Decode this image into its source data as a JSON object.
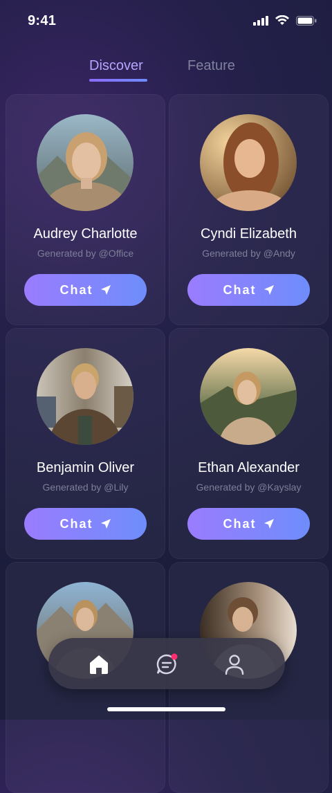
{
  "status_bar": {
    "time": "9:41"
  },
  "tabs": [
    {
      "label": "Discover",
      "active": true
    },
    {
      "label": "Feature",
      "active": false
    }
  ],
  "chat_button_label": "Chat",
  "cards": [
    {
      "name": "Audrey Charlotte",
      "generated_by": "Generated by @Office"
    },
    {
      "name": "Cyndi Elizabeth",
      "generated_by": "Generated by @Andy"
    },
    {
      "name": "Benjamin Oliver",
      "generated_by": "Generated by @Lily"
    },
    {
      "name": "Ethan Alexander",
      "generated_by": "Generated by @Kayslay"
    },
    {
      "name": "",
      "generated_by": ""
    },
    {
      "name": "",
      "generated_by": ""
    }
  ],
  "bottom_nav": {
    "items": [
      {
        "icon": "home-icon",
        "active": true
      },
      {
        "icon": "chat-bubble-icon",
        "badge": true
      },
      {
        "icon": "profile-icon",
        "active": false
      }
    ]
  },
  "colors": {
    "accent": "#8b6cff",
    "button_start": "#9a7cff",
    "button_end": "#6e8dfb",
    "badge": "#ff2e6e"
  }
}
